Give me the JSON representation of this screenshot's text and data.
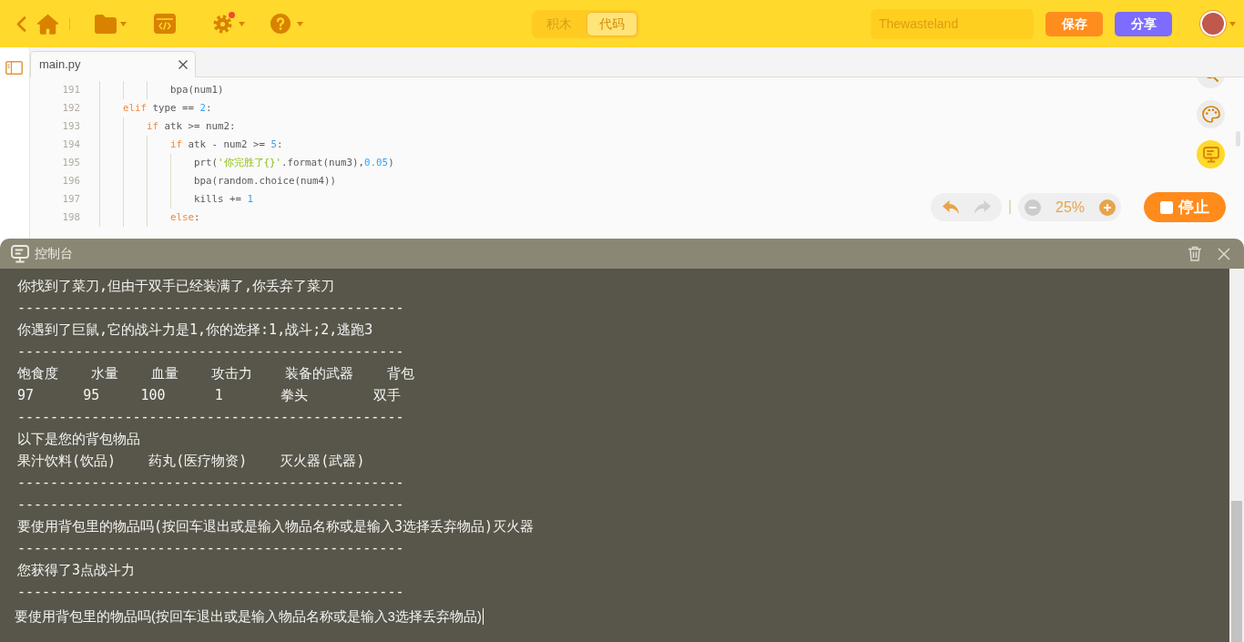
{
  "toolbar": {
    "settings_notification": true
  },
  "mode_tabs": [
    {
      "label": "积木",
      "selected": false
    },
    {
      "label": "代码",
      "selected": true
    }
  ],
  "project_name": {
    "value": "Thewasteland"
  },
  "actions": [
    {
      "kind": "save",
      "label": "保存"
    },
    {
      "kind": "share",
      "label": "分享"
    }
  ],
  "editor": {
    "tabs": [
      {
        "label": "main.py",
        "selected": true
      }
    ],
    "lines": [
      {
        "number": "191",
        "tokens": [
          {
            "kind": "plain",
            "text": "            bpa(num1)"
          }
        ]
      },
      {
        "number": "192",
        "tokens": [
          {
            "kind": "keyword",
            "text": "    elif"
          },
          {
            "kind": "plain",
            "text": " type == "
          },
          {
            "kind": "number",
            "text": "2"
          },
          {
            "kind": "plain",
            "text": ":"
          }
        ]
      },
      {
        "number": "193",
        "tokens": [
          {
            "kind": "keyword",
            "text": "        if"
          },
          {
            "kind": "plain",
            "text": " atk >= num2:"
          }
        ]
      },
      {
        "number": "194",
        "tokens": [
          {
            "kind": "keyword",
            "text": "            if"
          },
          {
            "kind": "plain",
            "text": " atk - num2 >= "
          },
          {
            "kind": "number",
            "text": "5"
          },
          {
            "kind": "plain",
            "text": ":"
          }
        ]
      },
      {
        "number": "195",
        "tokens": [
          {
            "kind": "plain",
            "text": "                prt("
          },
          {
            "kind": "string",
            "text": "'你完胜了{}'"
          },
          {
            "kind": "plain",
            "text": ".format(num3),"
          },
          {
            "kind": "number",
            "text": "0.05"
          },
          {
            "kind": "plain",
            "text": ")"
          }
        ]
      },
      {
        "number": "196",
        "tokens": [
          {
            "kind": "plain",
            "text": "                bpa(random.choice(num4))"
          }
        ]
      },
      {
        "number": "197",
        "tokens": [
          {
            "kind": "plain",
            "text": "                kills += "
          },
          {
            "kind": "number",
            "text": "1"
          }
        ]
      },
      {
        "number": "198",
        "tokens": [
          {
            "kind": "keyword",
            "text": "            else"
          },
          {
            "kind": "plain",
            "text": ":"
          }
        ]
      }
    ]
  },
  "side_tools": [
    {
      "kind": "search",
      "selected": false
    },
    {
      "kind": "palette",
      "selected": false
    },
    {
      "kind": "console",
      "selected": true
    }
  ],
  "history": [
    {
      "kind": "undo",
      "disabled": false
    },
    {
      "kind": "redo",
      "disabled": true
    }
  ],
  "zoom": {
    "reading": "25%",
    "zoom_out_disabled": true,
    "zoom_in_disabled": false
  },
  "run_button": {
    "label": "停止"
  },
  "console": {
    "title": "控制台",
    "lines": [
      "你找到了菜刀,但由于双手已经装满了,你丢弃了菜刀",
      "-----------------------------------------------",
      "你遇到了巨鼠,它的战斗力是1,你的选择:1,战斗;2,逃跑3",
      "-----------------------------------------------",
      "饱食度    水量    血量    攻击力    装备的武器    背包",
      "97      95     100      1       拳头        双手",
      "-----------------------------------------------",
      "以下是您的背包物品",
      "果汁饮料(饮品)    药丸(医疗物资)    灭火器(武器)",
      "-----------------------------------------------",
      "-----------------------------------------------",
      "要使用背包里的物品吗(按回车退出或是输入物品名称或是输入3选择丢弃物品)灭火器",
      "-----------------------------------------------",
      "您获得了3点战斗力",
      "-----------------------------------------------"
    ],
    "prompt": "要使用背包里的物品吗(按回车退出或是输入物品名称或是输入3选择丢弃物品)"
  }
}
